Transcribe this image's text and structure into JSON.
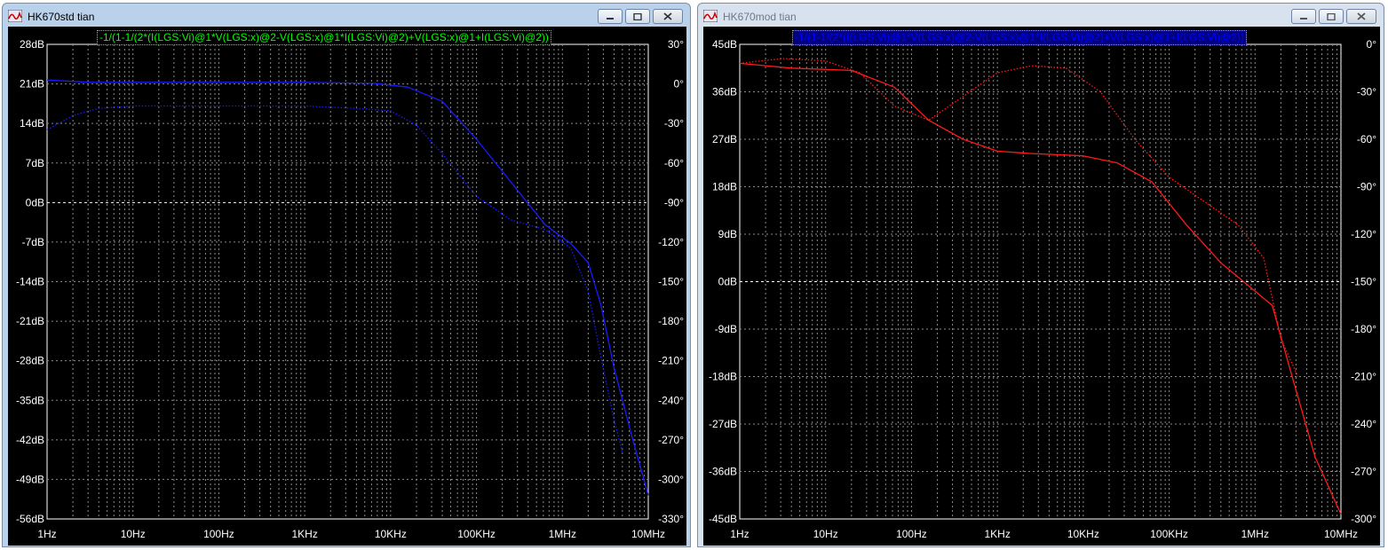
{
  "windows": [
    {
      "title": "HK670std tian",
      "active": true,
      "expression": "-1/(1-1/(2*(I(LGS:Vi)@1*V(LGS:x)@2-V(LGS:x)@1*I(LGS:Vi)@2)+V(LGS:x)@1+I(LGS:Vi)@2))",
      "expr_color": "#00ff00",
      "expr_bg": "#000000",
      "trace_color": "#1a1aff",
      "left_ticks": [
        "28dB",
        "21dB",
        "14dB",
        "7dB",
        "0dB",
        "-7dB",
        "-14dB",
        "-21dB",
        "-28dB",
        "-35dB",
        "-42dB",
        "-49dB",
        "-56dB"
      ],
      "right_ticks": [
        "30°",
        "0°",
        "-30°",
        "-60°",
        "-90°",
        "-120°",
        "-150°",
        "-180°",
        "-210°",
        "-240°",
        "-270°",
        "-300°",
        "-330°"
      ],
      "x_ticks": [
        "1Hz",
        "10Hz",
        "100Hz",
        "1KHz",
        "10KHz",
        "100KHz",
        "1MHz",
        "10MHz"
      ]
    },
    {
      "title": "HK670mod tian",
      "active": false,
      "expression": "-1/(1-1/(2*(I(LGS:Vi)@1*V(LGS:x)@2-V(LGS:x)@1*I(LGS:Vi)@2)+V(LGS:x)@1+I(LGS:Vi)@2))",
      "expr_color": "#0000ff",
      "expr_bg": "#000080",
      "trace_color": "#ff1a1a",
      "left_ticks": [
        "45dB",
        "36dB",
        "27dB",
        "18dB",
        "9dB",
        "0dB",
        "-9dB",
        "-18dB",
        "-27dB",
        "-36dB",
        "-45dB"
      ],
      "right_ticks": [
        "0°",
        "-30°",
        "-60°",
        "-90°",
        "-120°",
        "-150°",
        "-180°",
        "-210°",
        "-240°",
        "-270°",
        "-300°"
      ],
      "x_ticks": [
        "1Hz",
        "10Hz",
        "100Hz",
        "1KHz",
        "10KHz",
        "100KHz",
        "1MHz",
        "10MHz"
      ]
    }
  ],
  "icons": {
    "app": "ltspice-waveform-icon",
    "minimize": "minimize-icon",
    "maximize": "maximize-icon",
    "close": "close-icon"
  }
}
